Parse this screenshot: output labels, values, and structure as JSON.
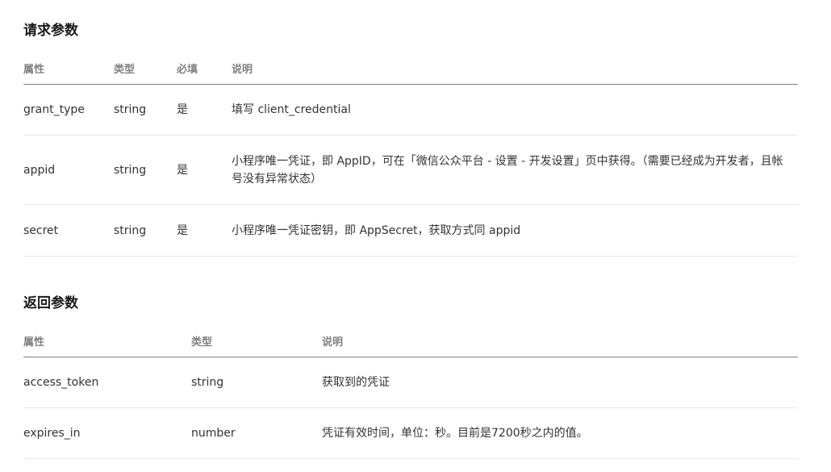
{
  "request": {
    "title": "请求参数",
    "headers": [
      "属性",
      "类型",
      "必填",
      "说明"
    ],
    "rows": [
      {
        "name": "grant_type",
        "type": "string",
        "required": "是",
        "desc": "填写 client_credential"
      },
      {
        "name": "appid",
        "type": "string",
        "required": "是",
        "desc": "小程序唯一凭证，即 AppID，可在「微信公众平台 - 设置 - 开发设置」页中获得。（需要已经成为开发者，且帐号没有异常状态）"
      },
      {
        "name": "secret",
        "type": "string",
        "required": "是",
        "desc": "小程序唯一凭证密钥，即 AppSecret，获取方式同 appid"
      }
    ]
  },
  "response": {
    "title": "返回参数",
    "headers": [
      "属性",
      "类型",
      "说明"
    ],
    "rows": [
      {
        "name": "access_token",
        "type": "string",
        "desc": "获取到的凭证"
      },
      {
        "name": "expires_in",
        "type": "number",
        "desc": "凭证有效时间，单位：秒。目前是7200秒之内的值。"
      }
    ]
  }
}
